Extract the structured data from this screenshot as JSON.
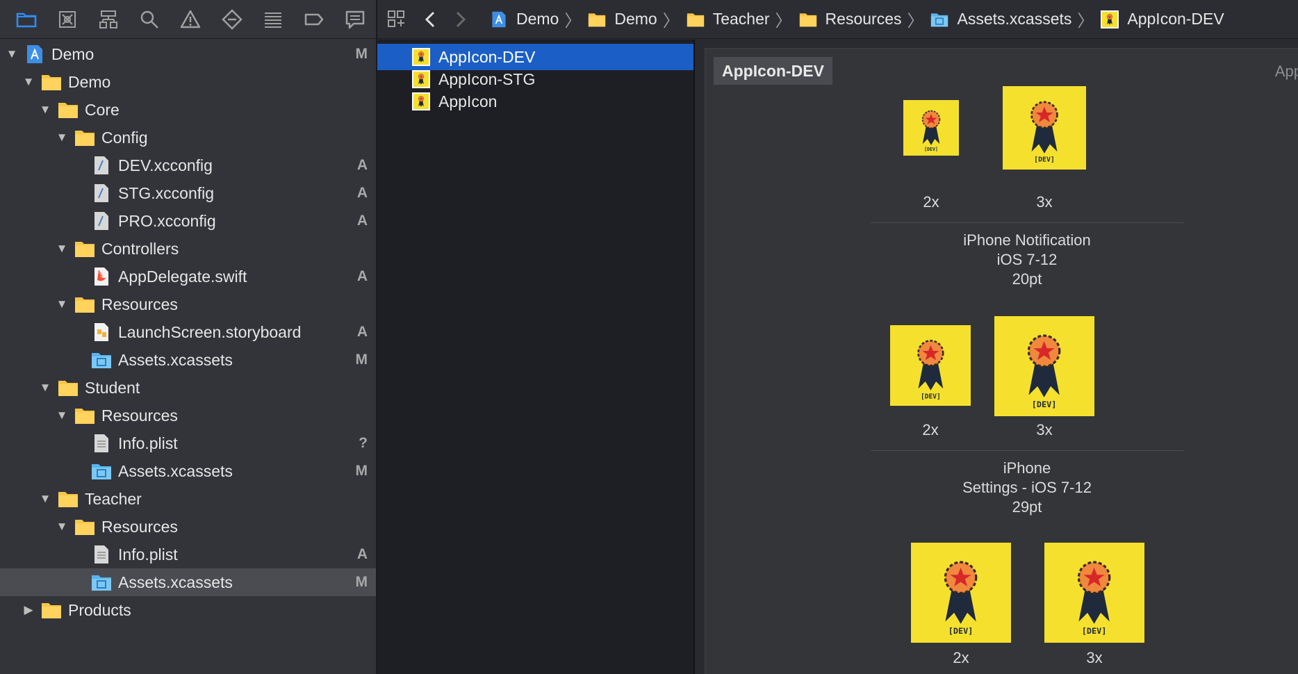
{
  "navigator": {
    "toolbar_icons": [
      "folder-icon",
      "source-control-icon",
      "hierarchy-icon",
      "search-icon",
      "warning-icon",
      "test-icon",
      "debug-icon",
      "breakpoint-icon",
      "report-icon"
    ],
    "tree": [
      {
        "label": "Demo",
        "status": "M"
      },
      {
        "label": "Demo",
        "status": ""
      },
      {
        "label": "Core",
        "status": ""
      },
      {
        "label": "Config",
        "status": ""
      },
      {
        "label": "DEV.xcconfig",
        "status": "A"
      },
      {
        "label": "STG.xcconfig",
        "status": "A"
      },
      {
        "label": "PRO.xcconfig",
        "status": "A"
      },
      {
        "label": "Controllers",
        "status": ""
      },
      {
        "label": "AppDelegate.swift",
        "status": "A"
      },
      {
        "label": "Resources",
        "status": ""
      },
      {
        "label": "LaunchScreen.storyboard",
        "status": "A"
      },
      {
        "label": "Assets.xcassets",
        "status": "M"
      },
      {
        "label": "Student",
        "status": ""
      },
      {
        "label": "Resources",
        "status": ""
      },
      {
        "label": "Info.plist",
        "status": "?"
      },
      {
        "label": "Assets.xcassets",
        "status": "M"
      },
      {
        "label": "Teacher",
        "status": ""
      },
      {
        "label": "Resources",
        "status": ""
      },
      {
        "label": "Info.plist",
        "status": "A"
      },
      {
        "label": "Assets.xcassets",
        "status": "M"
      },
      {
        "label": "Products",
        "status": ""
      }
    ]
  },
  "breadcrumb": [
    "Demo",
    "Demo",
    "Teacher",
    "Resources",
    "Assets.xcassets",
    "AppIcon-DEV"
  ],
  "asset_list": [
    "AppIcon-DEV",
    "AppIcon-STG",
    "AppIcon"
  ],
  "detail": {
    "title": "AppIcon-DEV",
    "right_label": "App",
    "badge_text": "[DEV]",
    "groups": [
      {
        "scales": [
          "2x",
          "3x"
        ],
        "caption": [
          "iPhone Notification",
          "iOS 7-12",
          "20pt"
        ]
      },
      {
        "scales": [
          "2x",
          "3x"
        ],
        "caption": [
          "iPhone",
          "Settings - iOS 7-12",
          "29pt"
        ]
      },
      {
        "scales": [
          "2x",
          "3x"
        ],
        "caption": []
      }
    ]
  },
  "colors": {
    "selection_blue": "#1b5fc6",
    "icon_yellow": "#f5e02e",
    "ribbon_navy": "#1f2a3c",
    "medal_orange": "#f0883e",
    "star_red": "#d62828",
    "folder_yellow": "#f6c64a",
    "xcassets_blue": "#5ab4ec"
  }
}
